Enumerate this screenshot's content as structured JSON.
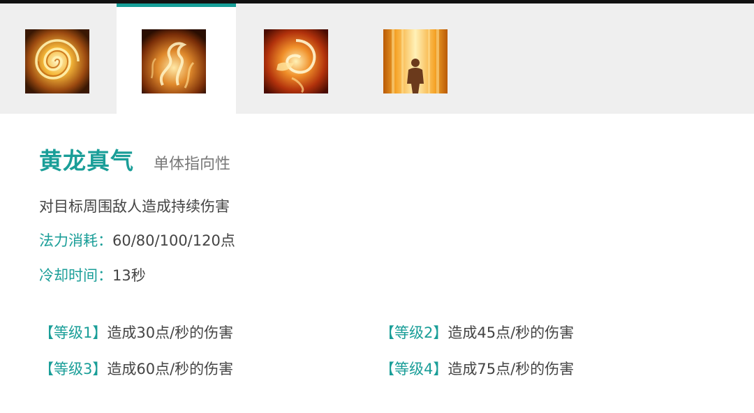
{
  "skill_tabs": [
    {
      "icon": "golden-vortex-icon",
      "active": false
    },
    {
      "icon": "golden-dragon-qi-icon",
      "active": true
    },
    {
      "icon": "fire-phoenix-icon",
      "active": false
    },
    {
      "icon": "golden-aura-figure-icon",
      "active": false
    }
  ],
  "skill": {
    "name": "黄龙真气",
    "type": "单体指向性",
    "description": "对目标周围敌人造成持续伤害",
    "cost_label": "法力消耗：",
    "cost_value": "60/80/100/120点",
    "cooldown_label": "冷却时间：",
    "cooldown_value": "13秒"
  },
  "levels": [
    {
      "tag": "【等级1】",
      "text": "造成30点/秒的伤害"
    },
    {
      "tag": "【等级2】",
      "text": "造成45点/秒的伤害"
    },
    {
      "tag": "【等级3】",
      "text": "造成60点/秒的伤害"
    },
    {
      "tag": "【等级4】",
      "text": "造成75点/秒的伤害"
    }
  ],
  "colors": {
    "accent": "#1a9e98",
    "tab_bar": "#efefef",
    "text": "#444444"
  }
}
